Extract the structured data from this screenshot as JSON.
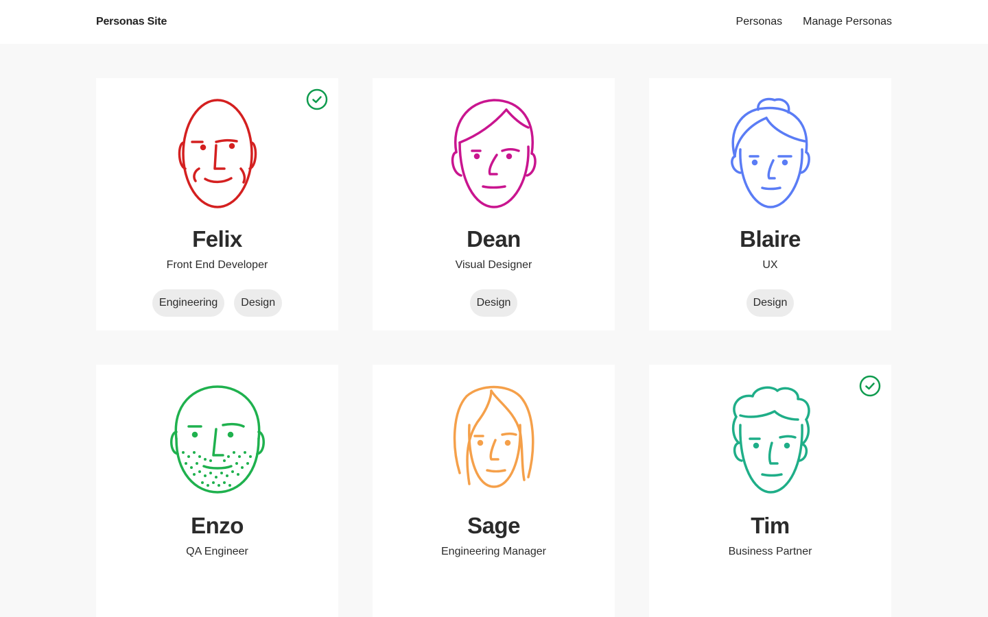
{
  "header": {
    "brand": "Personas Site",
    "nav": [
      "Personas",
      "Manage Personas"
    ]
  },
  "colors": {
    "check": "#0f9b4e",
    "felix": "#d42020",
    "dean": "#c9158f",
    "blaire": "#5a7cf5",
    "enzo": "#1fb14e",
    "sage": "#f5a04a",
    "tim": "#1fae88"
  },
  "personas": [
    {
      "name": "Felix",
      "role": "Front End Developer",
      "tags": [
        "Engineering",
        "Design"
      ],
      "selected": true
    },
    {
      "name": "Dean",
      "role": "Visual Designer",
      "tags": [
        "Design"
      ],
      "selected": false
    },
    {
      "name": "Blaire",
      "role": "UX",
      "tags": [
        "Design"
      ],
      "selected": false
    },
    {
      "name": "Enzo",
      "role": "QA Engineer",
      "tags": [],
      "selected": false
    },
    {
      "name": "Sage",
      "role": "Engineering Manager",
      "tags": [],
      "selected": false
    },
    {
      "name": "Tim",
      "role": "Business Partner",
      "tags": [],
      "selected": true
    }
  ]
}
